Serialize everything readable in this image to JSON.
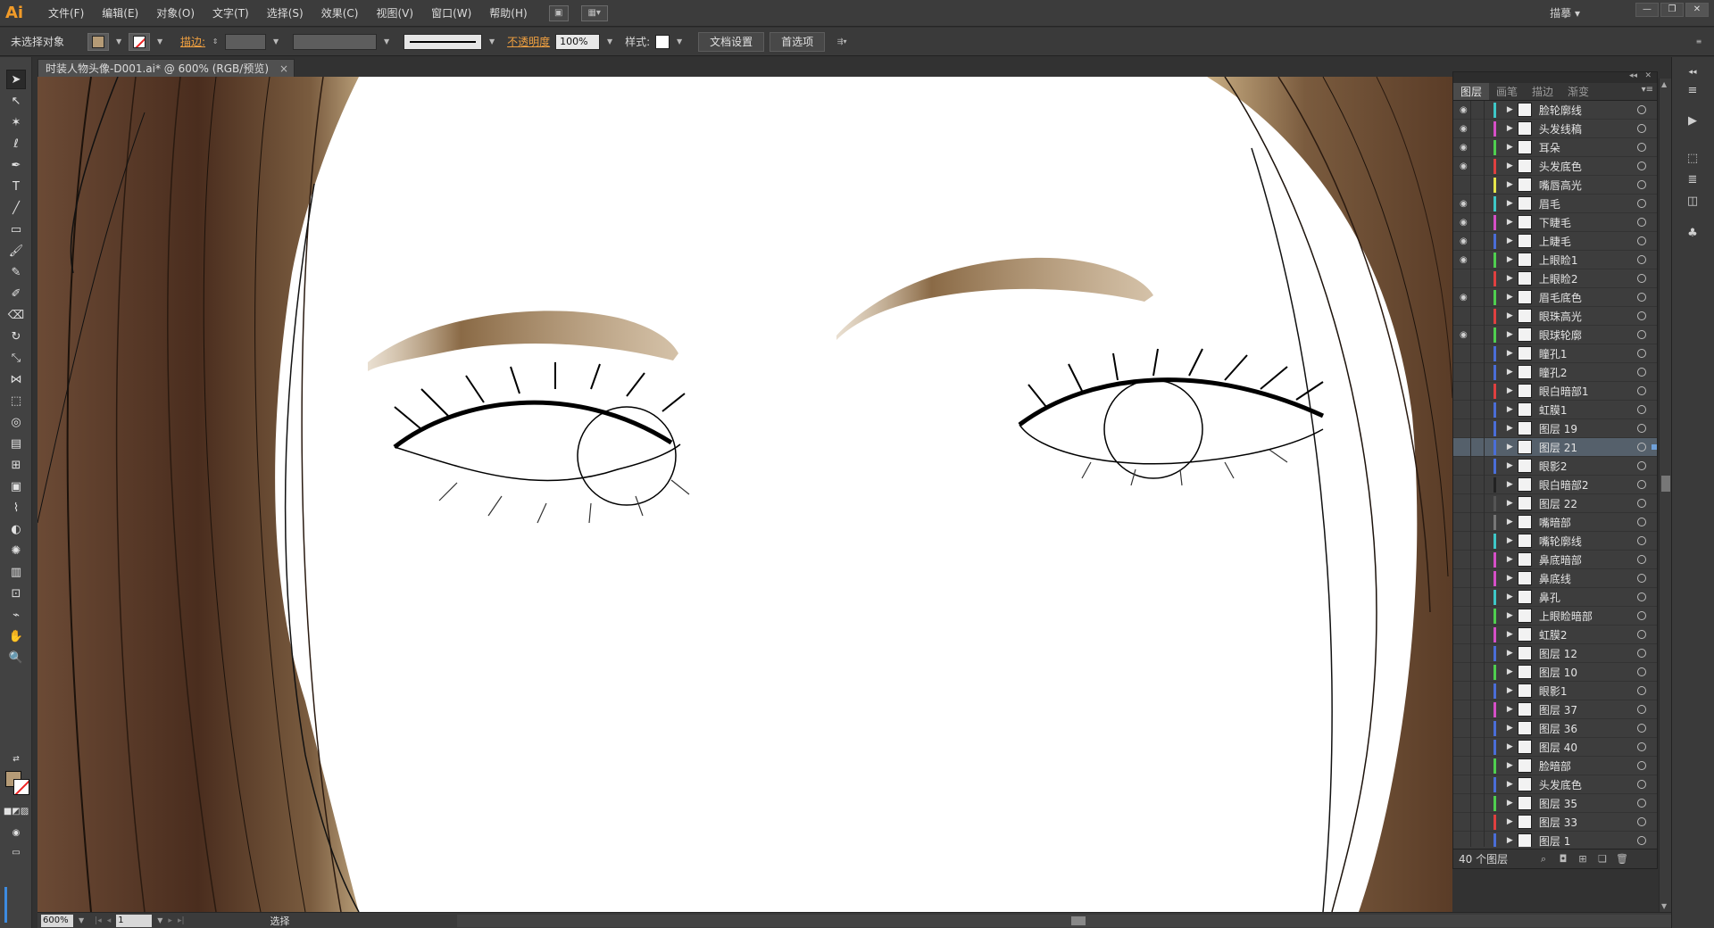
{
  "menubar": {
    "logo": "Ai",
    "items": [
      "文件(F)",
      "编辑(E)",
      "对象(O)",
      "文字(T)",
      "选择(S)",
      "效果(C)",
      "视图(V)",
      "窗口(W)",
      "帮助(H)"
    ],
    "workspace": "描摹 ▾"
  },
  "controlbar": {
    "selection_status": "未选择对象",
    "stroke_label": "描边:",
    "opacity_label": "不透明度",
    "opacity_value": "100%",
    "style_label": "样式:",
    "doc_setup_button": "文档设置",
    "prefs_button": "首选项"
  },
  "document": {
    "tab_title": "时装人物头像-D001.ai* @ 600% (RGB/预览)",
    "close": "×"
  },
  "statusbar": {
    "zoom": "600%",
    "page": "1",
    "tool_status": "选择"
  },
  "layers_panel": {
    "tabs": [
      "图层",
      "画笔",
      "描边",
      "渐变"
    ],
    "active_tab": "图层",
    "selected_index": 18,
    "layers": [
      {
        "name": "脸轮廓线",
        "visible": true,
        "color": "#3ec8c8"
      },
      {
        "name": "头发线稿",
        "visible": true,
        "color": "#d64fc7"
      },
      {
        "name": "耳朵",
        "visible": true,
        "color": "#4fcf4f"
      },
      {
        "name": "头发底色",
        "visible": true,
        "color": "#e04040"
      },
      {
        "name": "嘴唇高光",
        "visible": false,
        "color": "#e6e64a"
      },
      {
        "name": "眉毛",
        "visible": true,
        "color": "#3ec8c8"
      },
      {
        "name": "下睫毛",
        "visible": true,
        "color": "#d64fc7"
      },
      {
        "name": "上睫毛",
        "visible": true,
        "color": "#4a6ed8"
      },
      {
        "name": "上眼睑1",
        "visible": true,
        "color": "#4fcf4f"
      },
      {
        "name": "上眼睑2",
        "visible": false,
        "color": "#e04040"
      },
      {
        "name": "眉毛底色",
        "visible": true,
        "color": "#4fcf4f"
      },
      {
        "name": "眼珠高光",
        "visible": false,
        "color": "#e04040"
      },
      {
        "name": "眼球轮廓",
        "visible": true,
        "color": "#4fcf4f"
      },
      {
        "name": "瞳孔1",
        "visible": false,
        "color": "#4a6ed8"
      },
      {
        "name": "瞳孔2",
        "visible": false,
        "color": "#4a6ed8"
      },
      {
        "name": "眼白暗部1",
        "visible": false,
        "color": "#e04040"
      },
      {
        "name": "虹膜1",
        "visible": false,
        "color": "#4a6ed8"
      },
      {
        "name": "图层 19",
        "visible": false,
        "color": "#4a6ed8"
      },
      {
        "name": "图层 21",
        "visible": false,
        "color": "#4a6ed8"
      },
      {
        "name": "眼影2",
        "visible": false,
        "color": "#4a6ed8"
      },
      {
        "name": "眼白暗部2",
        "visible": false,
        "color": "#222222"
      },
      {
        "name": "图层 22",
        "visible": false,
        "color": "#555555"
      },
      {
        "name": "嘴暗部",
        "visible": false,
        "color": "#777777"
      },
      {
        "name": "嘴轮廓线",
        "visible": false,
        "color": "#3ec8c8"
      },
      {
        "name": "鼻底暗部",
        "visible": false,
        "color": "#d64fc7"
      },
      {
        "name": "鼻底线",
        "visible": false,
        "color": "#d64fc7"
      },
      {
        "name": "鼻孔",
        "visible": false,
        "color": "#3ec8c8"
      },
      {
        "name": "上眼睑暗部",
        "visible": false,
        "color": "#4fcf4f"
      },
      {
        "name": "虹膜2",
        "visible": false,
        "color": "#d64fc7"
      },
      {
        "name": "图层 12",
        "visible": false,
        "color": "#4a6ed8"
      },
      {
        "name": "图层 10",
        "visible": false,
        "color": "#4fcf4f"
      },
      {
        "name": "眼影1",
        "visible": false,
        "color": "#4a6ed8"
      },
      {
        "name": "图层 37",
        "visible": false,
        "color": "#d64fc7"
      },
      {
        "name": "图层 36",
        "visible": false,
        "color": "#4a6ed8"
      },
      {
        "name": "图层 40",
        "visible": false,
        "color": "#4a6ed8"
      },
      {
        "name": "脸暗部",
        "visible": false,
        "color": "#4fcf4f"
      },
      {
        "name": "头发底色",
        "visible": false,
        "color": "#4a6ed8"
      },
      {
        "name": "图层 35",
        "visible": false,
        "color": "#4fcf4f"
      },
      {
        "name": "图层 33",
        "visible": false,
        "color": "#e04040"
      },
      {
        "name": "图层 1",
        "visible": false,
        "color": "#4a6ed8"
      }
    ],
    "layer_count": "40 个图层"
  },
  "icons": {
    "eye": "eye-icon",
    "expand": "triangle-right-icon",
    "target": "target-circle-icon"
  }
}
